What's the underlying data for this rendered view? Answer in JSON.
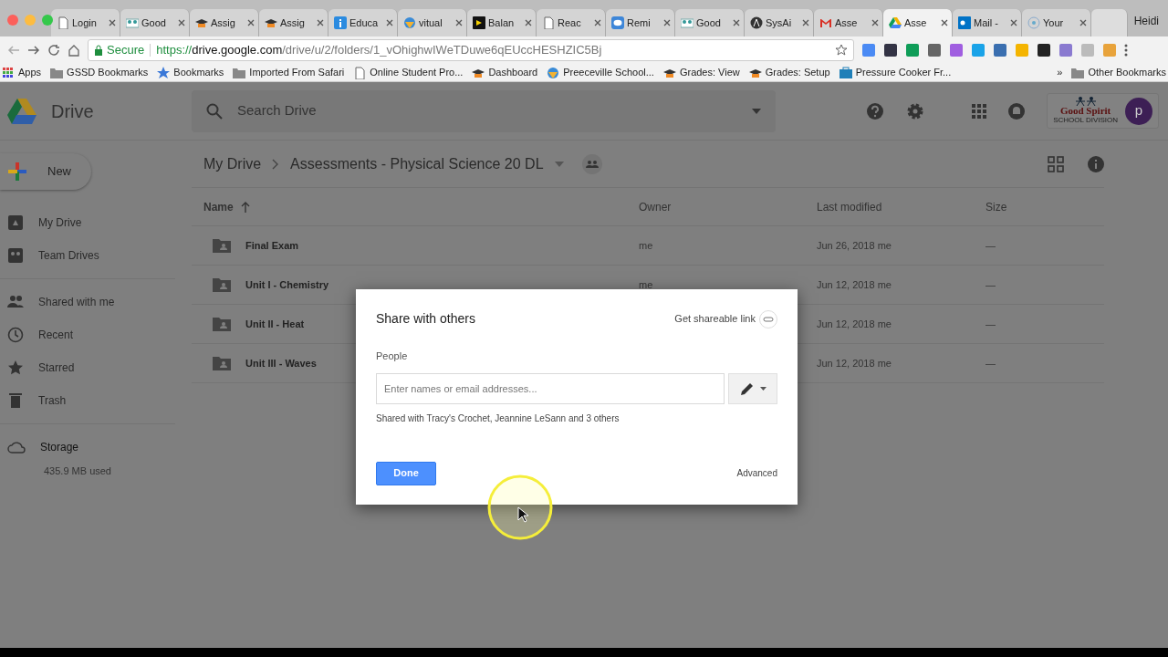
{
  "browser": {
    "tabs": [
      {
        "title": "Login",
        "kind": "page",
        "selected": false
      },
      {
        "title": "Good",
        "kind": "people",
        "selected": false
      },
      {
        "title": "Assig",
        "kind": "cap",
        "selected": false
      },
      {
        "title": "Assig",
        "kind": "cap",
        "selected": false
      },
      {
        "title": "Educa",
        "kind": "info",
        "selected": false
      },
      {
        "title": "vitual",
        "kind": "globe",
        "selected": false
      },
      {
        "title": "Balan",
        "kind": "dark",
        "selected": false
      },
      {
        "title": "Reac",
        "kind": "page",
        "selected": false
      },
      {
        "title": "Remi",
        "kind": "chat",
        "selected": false
      },
      {
        "title": "Good",
        "kind": "people",
        "selected": false
      },
      {
        "title": "SysAi",
        "kind": "circle",
        "selected": false
      },
      {
        "title": "Asse",
        "kind": "mail",
        "selected": false
      },
      {
        "title": "Asse",
        "kind": "drive",
        "selected": true
      },
      {
        "title": "Mail -",
        "kind": "outlook",
        "selected": false
      },
      {
        "title": "Your",
        "kind": "ring",
        "selected": false
      }
    ],
    "profile": "Heidi",
    "secure": "Secure",
    "url": {
      "scheme": "https://",
      "host": "drive.google.com",
      "path": "/drive/u/2/folders/1_vOhighwIWeTDuwe6qEUccHESHZIC5Bj"
    },
    "bookmarks": [
      {
        "label": "Apps",
        "kind": "apps"
      },
      {
        "label": "GSSD Bookmarks",
        "kind": "folder"
      },
      {
        "label": "Bookmarks",
        "kind": "star"
      },
      {
        "label": "Imported From Safari",
        "kind": "folder"
      },
      {
        "label": "Online Student Pro...",
        "kind": "page"
      },
      {
        "label": "Dashboard",
        "kind": "cap"
      },
      {
        "label": "Preeceville School...",
        "kind": "globe"
      },
      {
        "label": "Grades: View",
        "kind": "cap"
      },
      {
        "label": "Grades: Setup",
        "kind": "cap"
      },
      {
        "label": "Pressure Cooker Fr...",
        "kind": "case"
      }
    ],
    "more": "»",
    "other_bookmarks": "Other Bookmarks"
  },
  "drive": {
    "app_name": "Drive",
    "search_placeholder": "Search Drive",
    "logo_name": "Good Spirit",
    "logo_sub": "SCHOOL DIVISION",
    "avatar": "p",
    "new_button": "New",
    "nav_groups": [
      {
        "items": [
          {
            "label": "My Drive",
            "kind": "drive"
          },
          {
            "label": "Team Drives",
            "kind": "team"
          }
        ]
      },
      {
        "items": [
          {
            "label": "Shared with me",
            "kind": "people"
          },
          {
            "label": "Recent",
            "kind": "clock"
          },
          {
            "label": "Starred",
            "kind": "star"
          },
          {
            "label": "Trash",
            "kind": "trash"
          }
        ]
      }
    ],
    "storage": {
      "label": "Storage",
      "usage": "435.9 MB used"
    },
    "breadcrumb": [
      "My Drive",
      "Assessments - Physical Science 20 DL"
    ],
    "table": {
      "columns": [
        "Name",
        "Owner",
        "Last modified",
        "Size"
      ],
      "rows": [
        {
          "name": "Final Exam",
          "owner": "me",
          "modified": "Jun 26, 2018 me",
          "size": "—"
        },
        {
          "name": "Unit I - Chemistry",
          "owner": "me",
          "modified": "Jun 12, 2018 me",
          "size": "—"
        },
        {
          "name": "Unit II - Heat",
          "modified": "Jun 12, 2018 me",
          "size": "—"
        },
        {
          "name": "Unit III - Waves",
          "modified": "Jun 12, 2018 me",
          "size": "—"
        }
      ]
    }
  },
  "dialog": {
    "title": "Share with others",
    "link_label": "Get shareable link",
    "people_label": "People",
    "placeholder": "Enter names or email addresses...",
    "shared_with": "Shared with Tracy's Crochet, Jeannine LeSann and 3 others",
    "done": "Done",
    "advanced": "Advanced"
  }
}
